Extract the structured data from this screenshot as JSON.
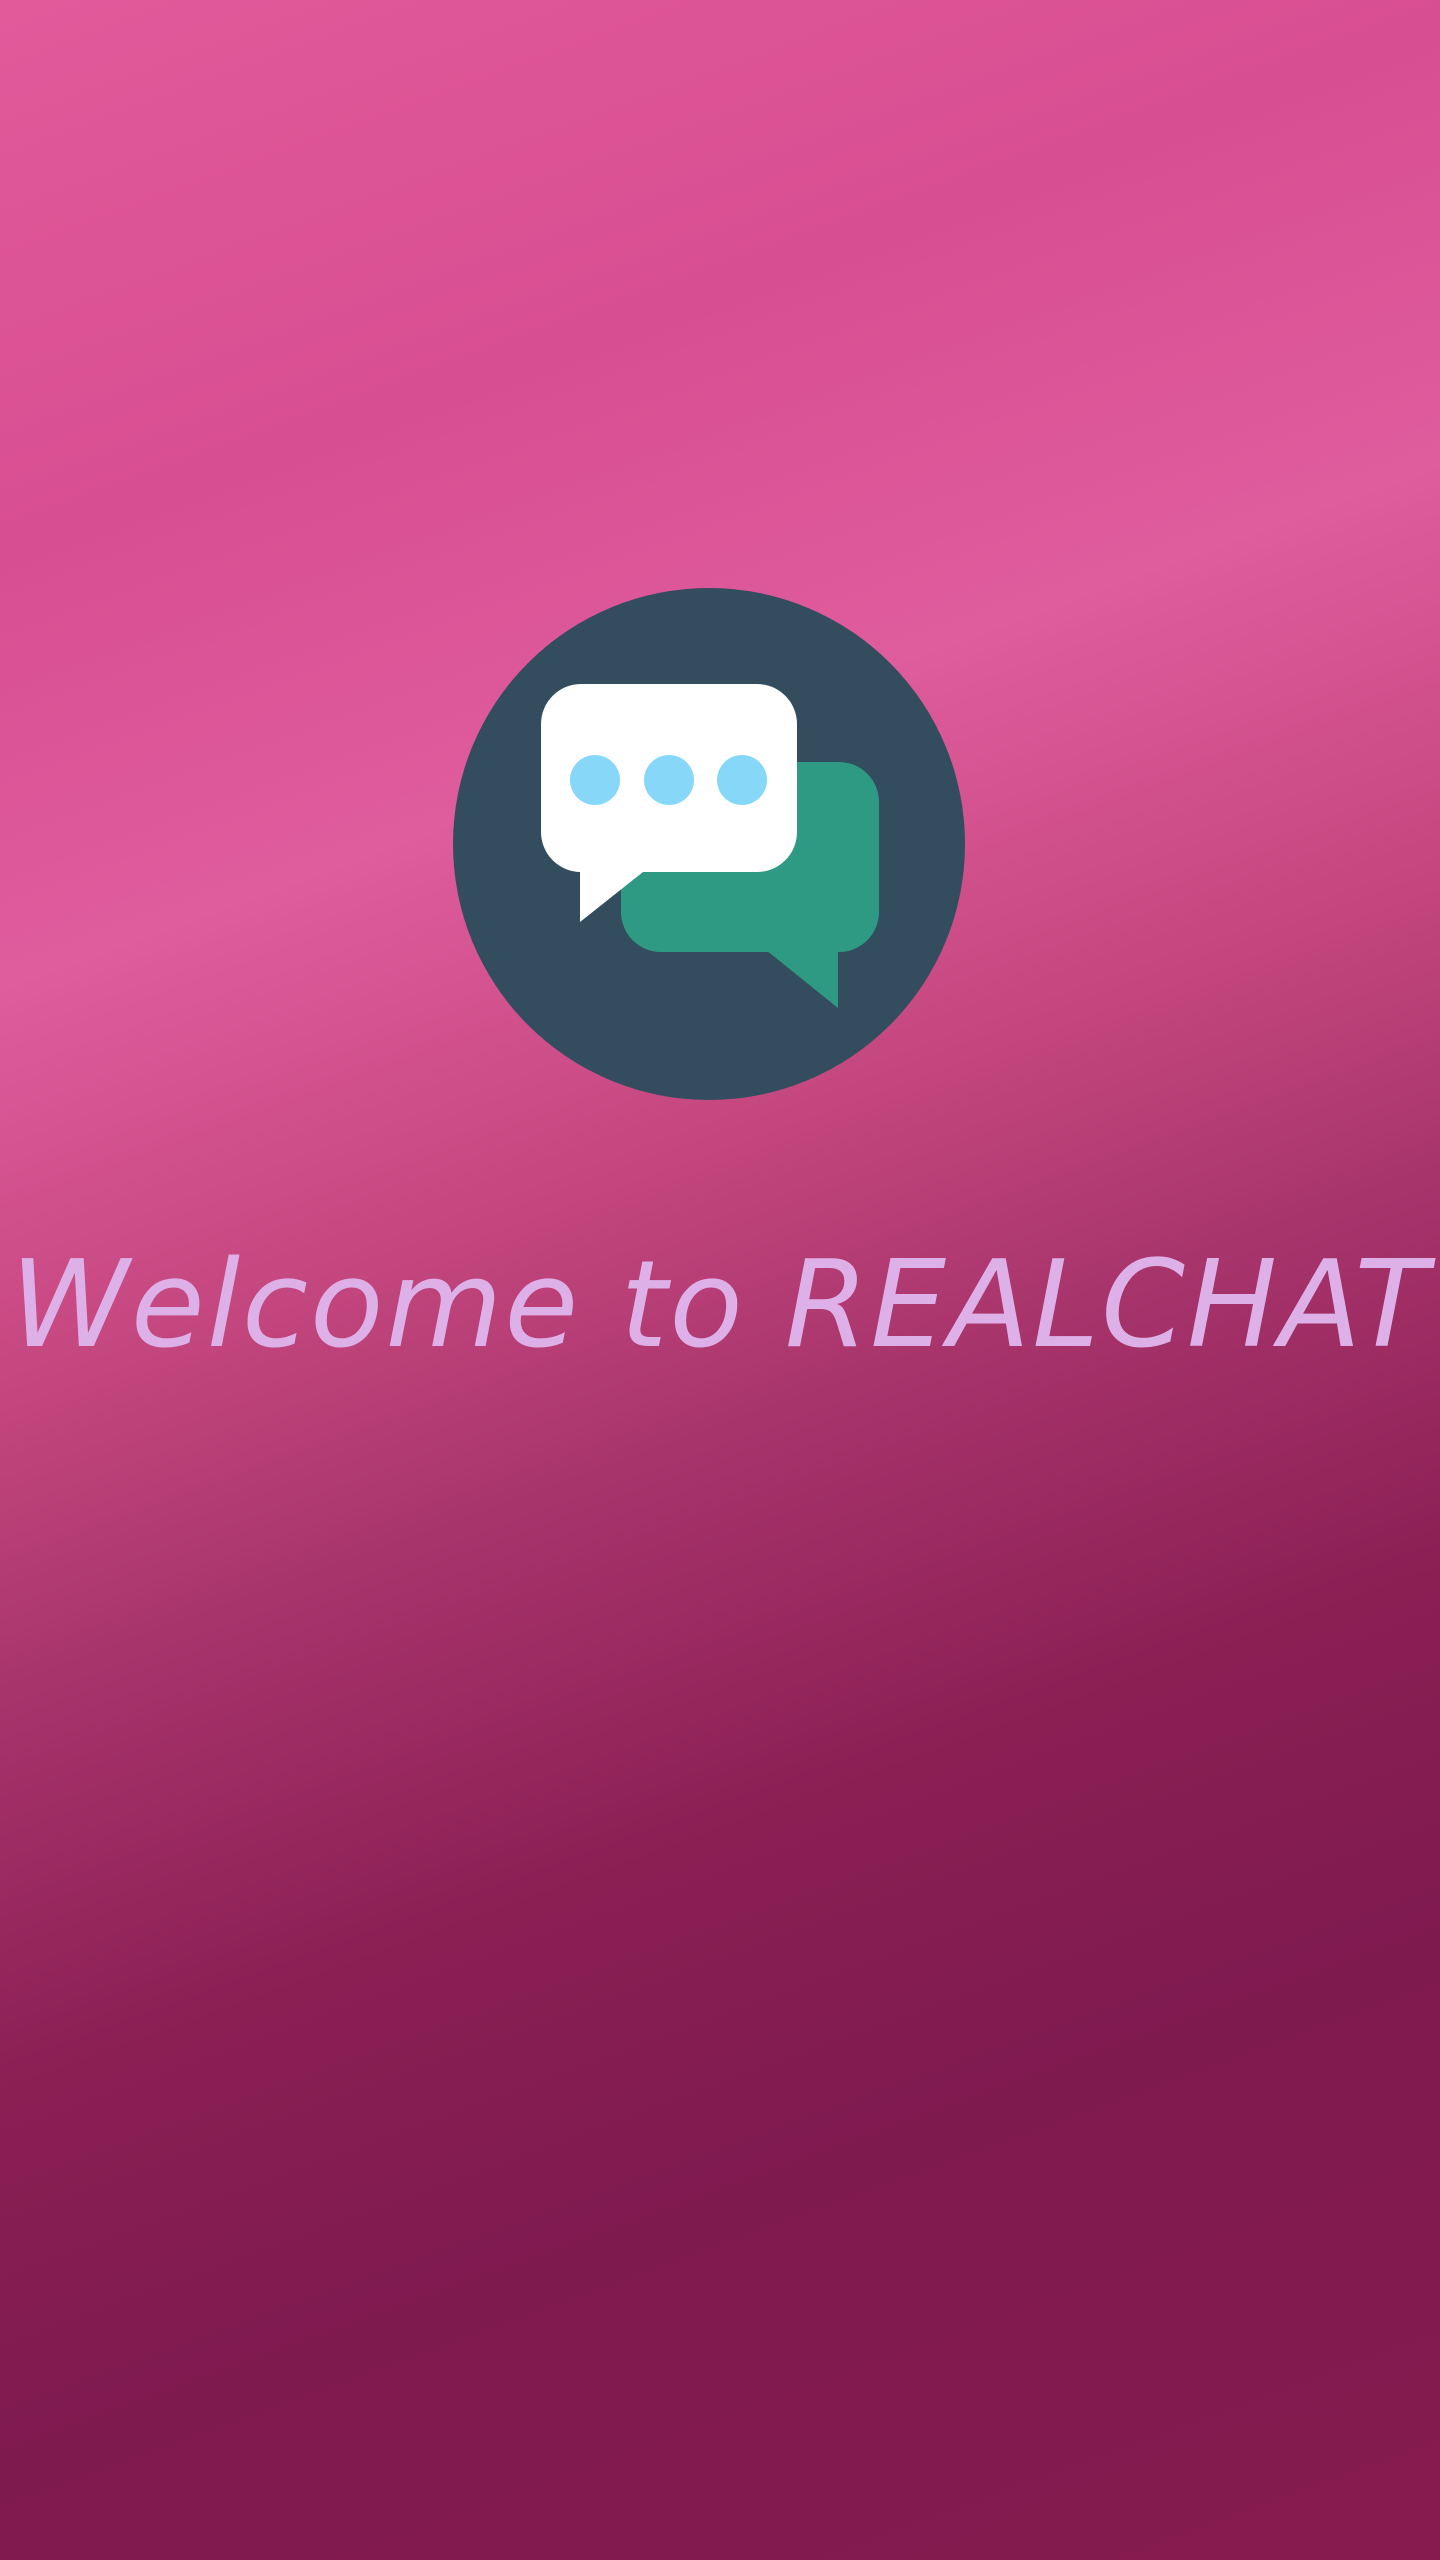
{
  "splash": {
    "welcome_text": "Welcome to REALCHAT",
    "logo_icon": "chat-bubbles-icon"
  },
  "colors": {
    "logo_circle": "#334d5f",
    "front_bubble": "#ffffff",
    "back_bubble": "#2f9a84",
    "dots": "#86d7f8",
    "text": "#ddb1e8"
  }
}
